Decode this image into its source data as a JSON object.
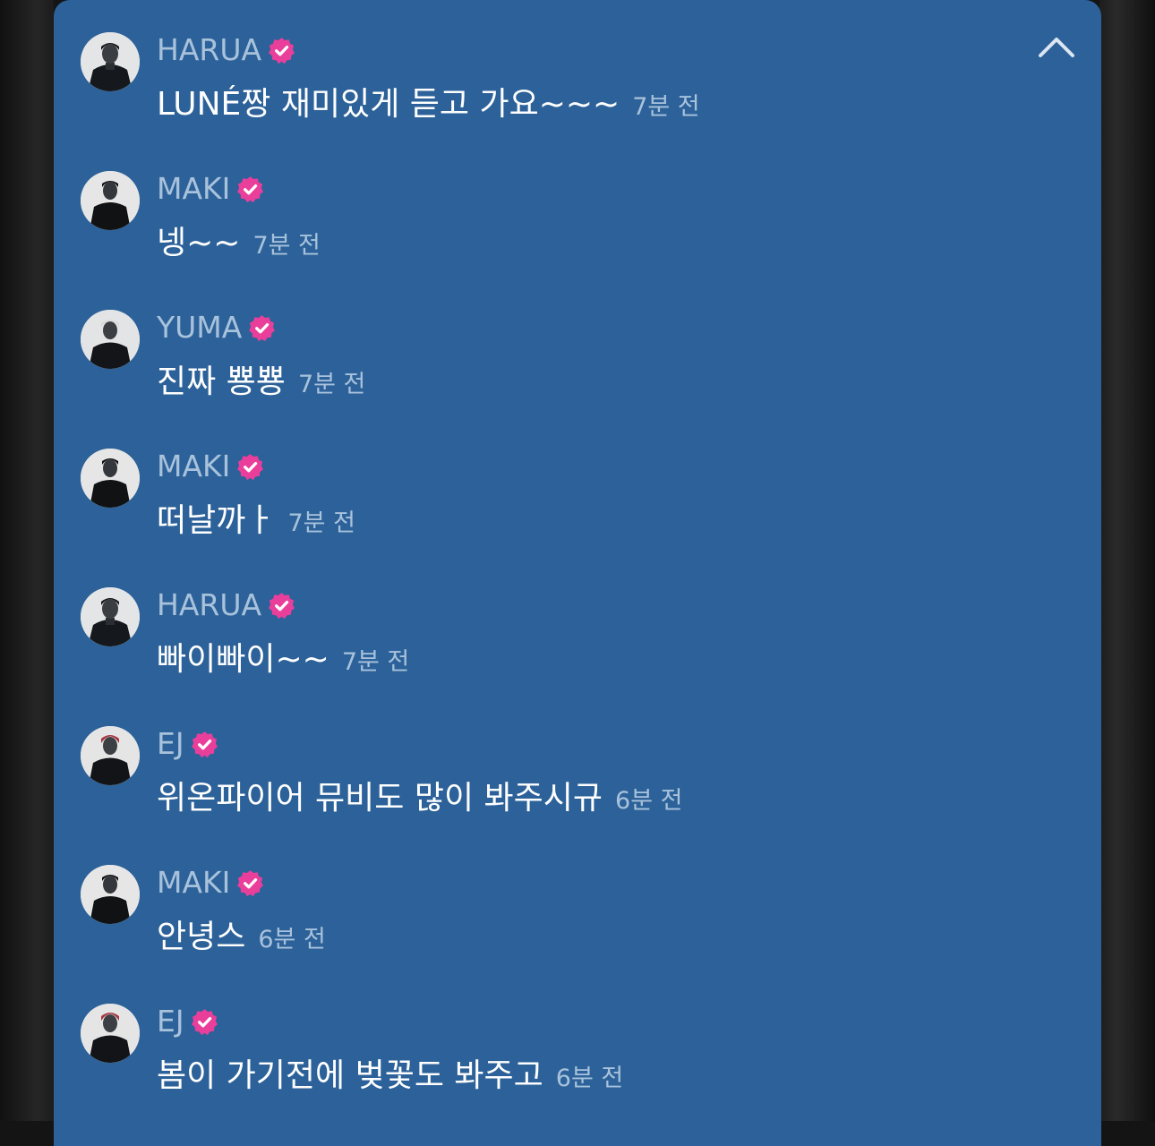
{
  "colors": {
    "panel_bg": "#2c6299",
    "author_name": "#a9c2dc",
    "message_text": "#ffffff",
    "timestamp": "#a9c2dc",
    "verified_badge": "#ea3e9b",
    "page_bg": "#141414"
  },
  "header": {
    "collapse_icon": "chevron-up-icon"
  },
  "messages": [
    {
      "author": "HARUA",
      "verified": true,
      "text": "LUNÉ짱 재미있게 듣고 가요~~~",
      "time": "7분 전"
    },
    {
      "author": "MAKI",
      "verified": true,
      "text": "넹~~",
      "time": "7분 전"
    },
    {
      "author": "YUMA",
      "verified": true,
      "text": "진짜 뿅뿅",
      "time": "7분 전"
    },
    {
      "author": "MAKI",
      "verified": true,
      "text": "떠날까ㅏ",
      "time": "7분 전"
    },
    {
      "author": "HARUA",
      "verified": true,
      "text": "빠이빠이~~",
      "time": "7분 전"
    },
    {
      "author": "EJ",
      "verified": true,
      "text": "위온파이어 뮤비도 많이 봐주시규",
      "time": "6분 전"
    },
    {
      "author": "MAKI",
      "verified": true,
      "text": "안녕스",
      "time": "6분 전"
    },
    {
      "author": "EJ",
      "verified": true,
      "text": "봄이 가기전에 벚꽃도 봐주고",
      "time": "6분 전"
    }
  ]
}
